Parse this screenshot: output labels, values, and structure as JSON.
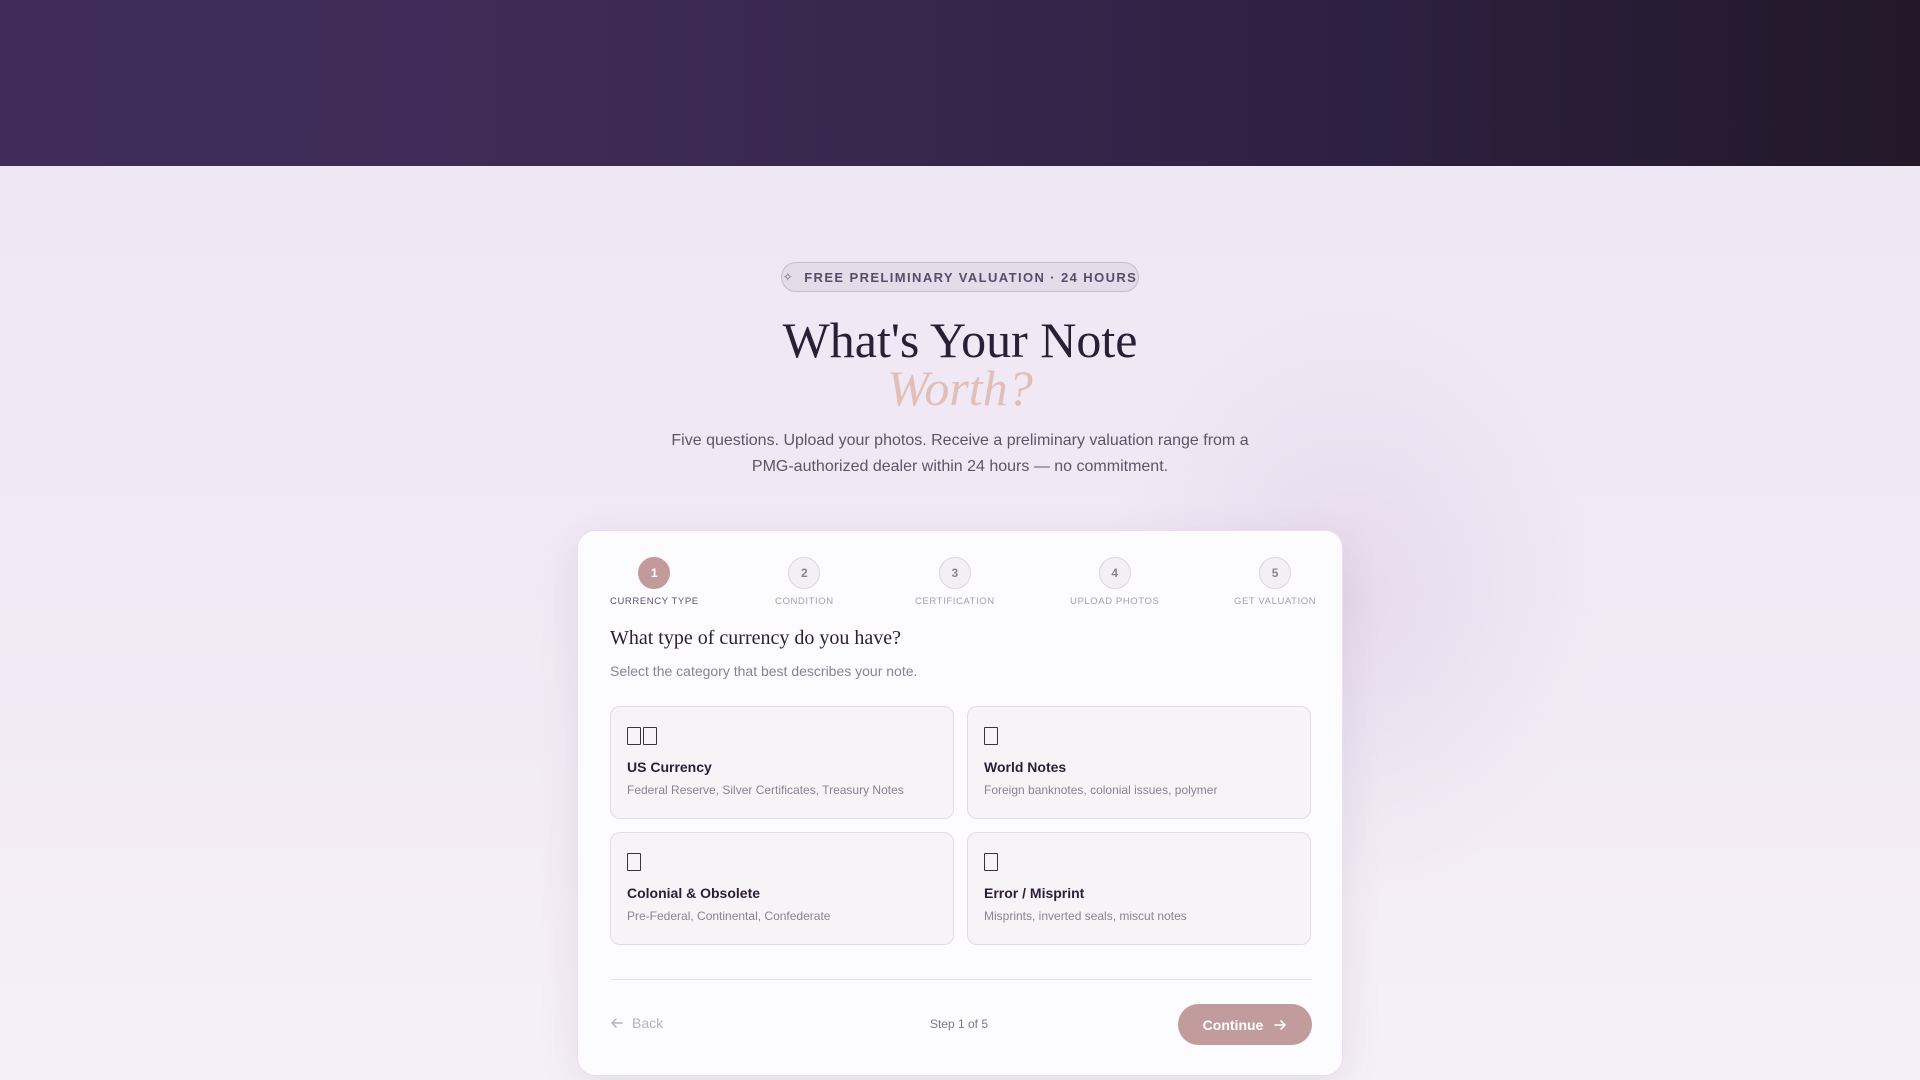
{
  "hero": {
    "badge_icon": "sparkle-icon",
    "badge": "FREE PRELIMINARY VALUATION · 24 HOURS",
    "title": "What's Your Note",
    "title_emphasis": "Worth?",
    "subtitle": "Five questions. Upload your photos. Receive a preliminary valuation range from a PMG-authorized dealer within 24 hours — no commitment."
  },
  "steps": [
    {
      "number": "1",
      "label": "CURRENCY TYPE",
      "active": true
    },
    {
      "number": "2",
      "label": "CONDITION",
      "active": false
    },
    {
      "number": "3",
      "label": "CERTIFICATION",
      "active": false
    },
    {
      "number": "4",
      "label": "UPLOAD PHOTOS",
      "active": false
    },
    {
      "number": "5",
      "label": "GET VALUATION",
      "active": false
    }
  ],
  "question": {
    "title": "What type of currency do you have?",
    "subtitle": "Select the category that best describes your note."
  },
  "options": [
    {
      "icon": "us-flag-icon",
      "name": "US Currency",
      "description": "Federal Reserve, Silver Certificates, Treasury Notes"
    },
    {
      "icon": "globe-icon",
      "name": "World Notes",
      "description": "Foreign banknotes, colonial issues, polymer"
    },
    {
      "icon": "scroll-icon",
      "name": "Colonial & Obsolete",
      "description": "Pre-Federal, Continental, Confederate"
    },
    {
      "icon": "magnifier-icon",
      "name": "Error / Misprint",
      "description": "Misprints, inverted seals, miscut notes"
    }
  ],
  "footer": {
    "back_label": "Back",
    "step_status": "Step 1 of 5",
    "continue_label": "Continue"
  },
  "colors": {
    "header_band": "#3f2c59",
    "accent": "#c29b9c",
    "title_emphasis": "#e1bfb8"
  }
}
